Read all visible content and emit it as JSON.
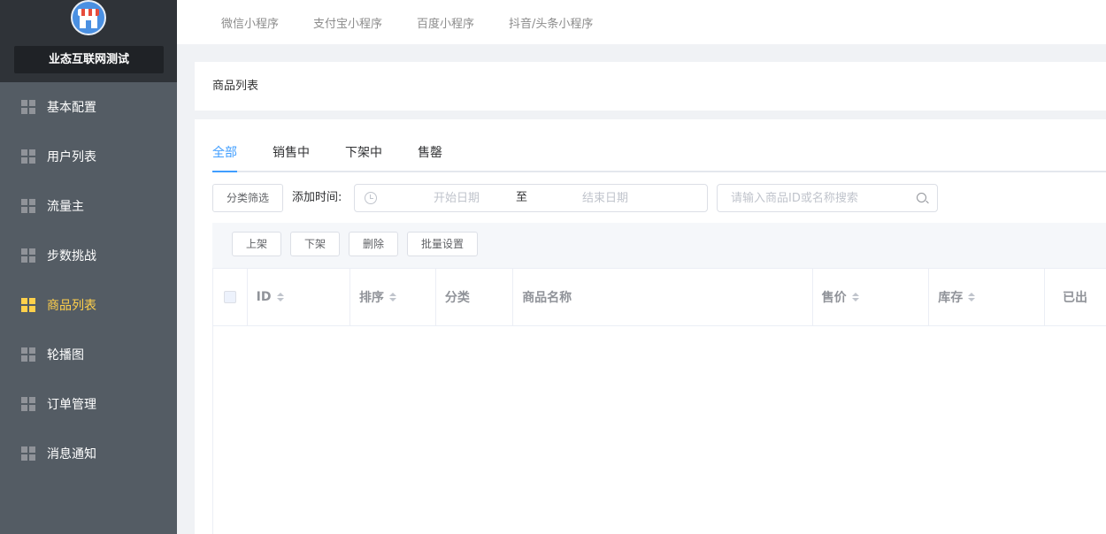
{
  "sidebar": {
    "shop_name": "业态互联网测试",
    "items": [
      {
        "label": "基本配置",
        "active": false
      },
      {
        "label": "用户列表",
        "active": false
      },
      {
        "label": "流量主",
        "active": false
      },
      {
        "label": "步数挑战",
        "active": false
      },
      {
        "label": "商品列表",
        "active": true
      },
      {
        "label": "轮播图",
        "active": false
      },
      {
        "label": "订单管理",
        "active": false
      },
      {
        "label": "消息通知",
        "active": false
      }
    ],
    "icon": "grid-icon",
    "colors": {
      "background": "#545c64",
      "active": "#ffd04b",
      "text": "#ffffff"
    }
  },
  "topbar": {
    "tabs": [
      "微信小程序",
      "支付宝小程序",
      "百度小程序",
      "抖音/头条小程序"
    ]
  },
  "page": {
    "title": "商品列表"
  },
  "status_tabs": {
    "items": [
      "全部",
      "销售中",
      "下架中",
      "售罄"
    ],
    "active_index": 0,
    "accent": "#409eff"
  },
  "filters": {
    "category_button": "分类筛选",
    "time_label": "添加时间:",
    "start_placeholder": "开始日期",
    "range_separator": "至",
    "end_placeholder": "结束日期",
    "search_placeholder": "请输入商品ID或名称搜索"
  },
  "batch_actions": {
    "on_shelf": "上架",
    "off_shelf": "下架",
    "delete": "删除",
    "batch_settings": "批量设置"
  },
  "table": {
    "columns": [
      {
        "label": "ID",
        "sortable": true
      },
      {
        "label": "排序",
        "sortable": true
      },
      {
        "label": "分类",
        "sortable": false
      },
      {
        "label": "商品名称",
        "sortable": false
      },
      {
        "label": "售价",
        "sortable": true
      },
      {
        "label": "库存",
        "sortable": true
      },
      {
        "label": "已出",
        "sortable": false
      }
    ],
    "rows": []
  }
}
